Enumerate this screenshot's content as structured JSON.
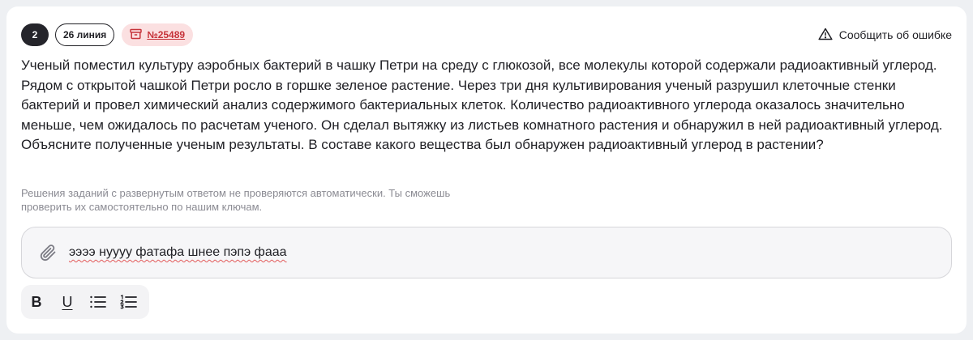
{
  "header": {
    "task_number": "2",
    "line_label": "26 линия",
    "task_id": "№25489",
    "report_label": "Сообщить об ошибке"
  },
  "question": {
    "text": "Ученый поместил культуру аэробных бактерий в чашку Петри на среду с глюкозой, все молекулы которой содержали радиоактивный углерод. Рядом с открытой чашкой Петри росло в горшке зеленое растение. Через три дня культивирования ученый разрушил клеточные стенки бактерий и провел химический анализ содержимого бактериальных клеток. Количество радиоактивного углерода оказалось значительно меньше, чем ожидалось по расчетам ученого. Он сделал вытяжку из листьев комнатного растения и обнаружил в ней радиоактивный углерод. Объясните полученные ученым результаты. В составе какого вещества был обнаружен радиоактивный углерод в растении?"
  },
  "note": {
    "line1": "Решения заданий с развернутым ответом не проверяются автоматически. Ты сможешь",
    "line2": "проверить их самостоятельно по нашим ключам."
  },
  "answer": {
    "value": "ээээ нуууу фатафа шнее пэпэ фааа"
  },
  "toolbar": {
    "bold_label": "B",
    "underline_label": "U"
  },
  "icons": {
    "report": "warning-triangle-icon",
    "task_id": "archive-box-icon",
    "attach": "paperclip-icon",
    "bullets": "bulleted-list-icon",
    "numbers": "numbered-list-icon"
  },
  "colors": {
    "accent_red": "#c6333a",
    "badge_pink": "#fbe0e1",
    "dark_badge": "#25252b"
  }
}
